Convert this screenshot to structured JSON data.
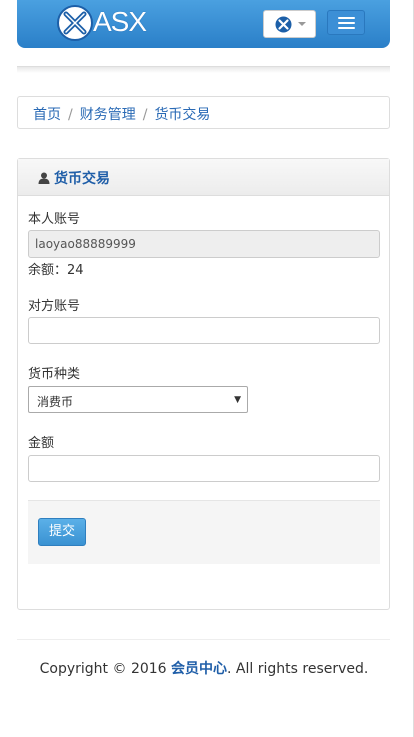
{
  "brand": {
    "logo_text": "ASX"
  },
  "navbar": {
    "lang_icon": "flag-icon",
    "menu_icon": "hamburger-icon"
  },
  "breadcrumb": {
    "items": [
      "首页",
      "财务管理",
      "货币交易"
    ],
    "separator": "/"
  },
  "panel": {
    "title": "货币交易",
    "own_account_label": "本人账号",
    "own_account_value": "laoyao88889999",
    "balance_text": "余额：24",
    "target_account_label": "对方账号",
    "target_account_value": "",
    "currency_label": "货币种类",
    "currency_selected": "消费币",
    "amount_label": "金额",
    "amount_value": "",
    "submit_label": "提交"
  },
  "footer": {
    "prefix": "Copyright © 2016 ",
    "brand": "会员中心",
    "suffix": ". All rights reserved."
  },
  "colors": {
    "navbar": "#2a7fc8",
    "accent": "#1f5ea8",
    "button": "#3a92d2"
  }
}
